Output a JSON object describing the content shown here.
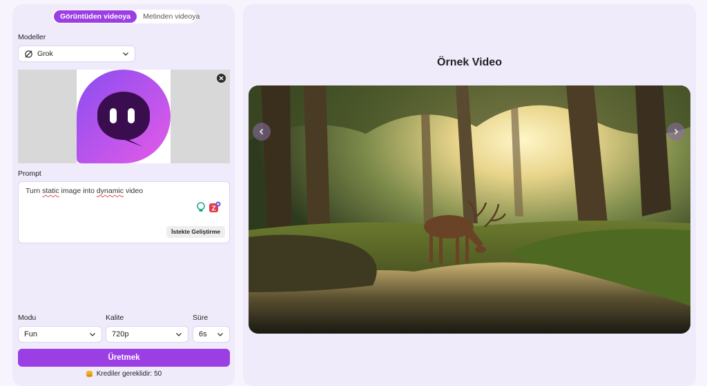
{
  "tabs": {
    "image_to_video": "Görüntüden videoya",
    "text_to_video": "Metinden videoya"
  },
  "models": {
    "label": "Modeller",
    "selected": "Grok"
  },
  "prompt": {
    "label": "Prompt",
    "value_parts": [
      "Turn ",
      "static",
      " image into ",
      "dynamic",
      " video"
    ],
    "enhance_label": "İstekte Geliştirme"
  },
  "settings": {
    "mode_label": "Modu",
    "mode_value": "Fun",
    "quality_label": "Kalite",
    "quality_value": "720p",
    "duration_label": "Süre",
    "duration_value": "6s"
  },
  "generate_label": "Üretmek",
  "credits_text": "Krediler gereklidir: 50",
  "sample": {
    "title": "Örnek Video"
  },
  "colors": {
    "accent": "#9b3ee3",
    "panel": "#efebfb"
  },
  "icons": [
    "grok-icon",
    "chevron-down-icon",
    "close-icon",
    "lightbulb-icon",
    "enhance-badge-icon",
    "coin-icon",
    "chevron-left-icon",
    "chevron-right-icon"
  ]
}
